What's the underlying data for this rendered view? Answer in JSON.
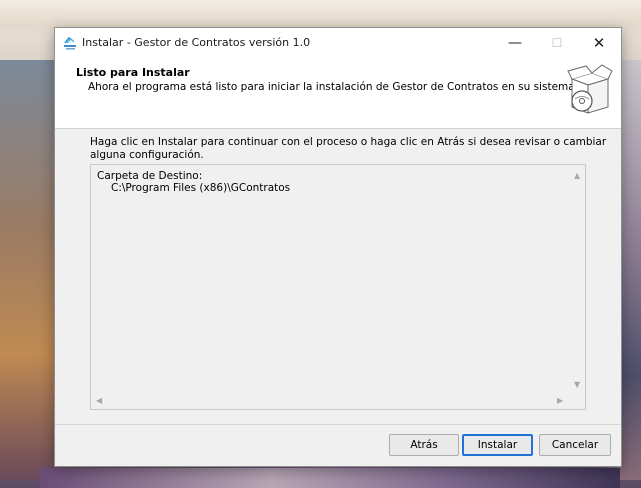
{
  "window": {
    "title": "Instalar - Gestor de Contratos versión 1.0",
    "minimize_glyph": "—",
    "maximize_glyph": "☐",
    "close_glyph": "✕"
  },
  "header": {
    "title": "Listo para Instalar",
    "description": "Ahora el programa está listo para iniciar la instalación de Gestor de Contratos en su sistema.",
    "icon": "setup-box-with-disc-icon"
  },
  "body": {
    "intro": "Haga clic en Instalar para continuar con el proceso o haga clic en Atrás si desea revisar o cambiar alguna configuración.",
    "summary_lines": [
      "Carpeta de Destino:",
      "C:\\Program Files (x86)\\GContratos"
    ]
  },
  "buttons": {
    "back": "Atrás",
    "install": "Instalar",
    "cancel": "Cancelar"
  },
  "colors": {
    "accent": "#1e72d8",
    "window_bg": "#f0f0f0"
  }
}
